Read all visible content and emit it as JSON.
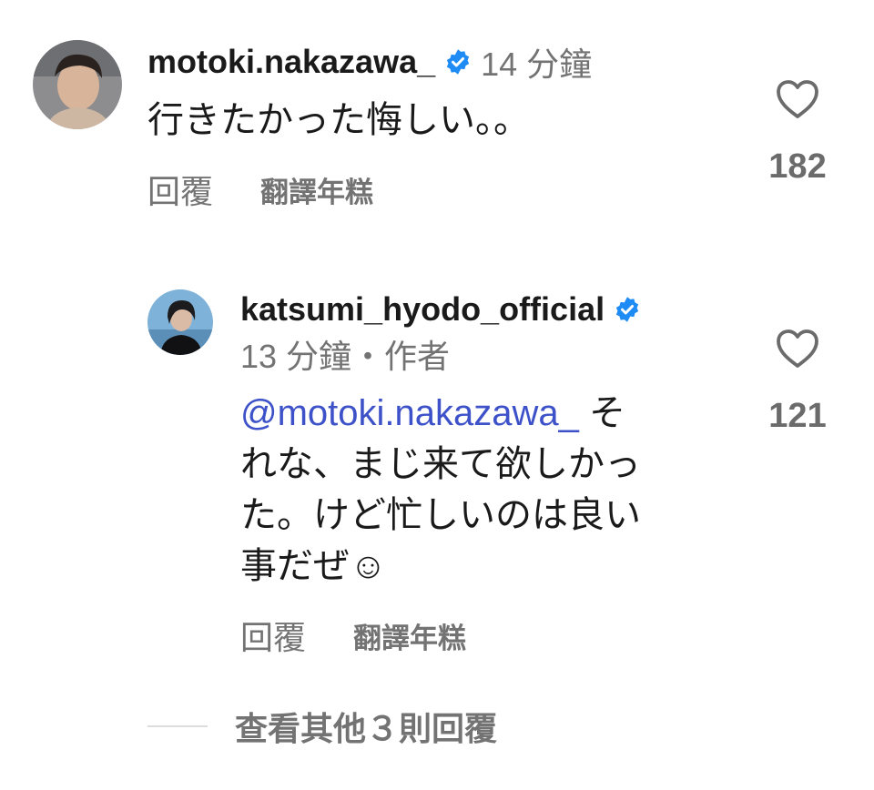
{
  "colors": {
    "text": "#1a1a1a",
    "secondary": "#737373",
    "mention": "#3d52c9",
    "verified": "#1f8cf5"
  },
  "comments": [
    {
      "username": "motoki.nakazawa_",
      "verified": true,
      "timestamp": "14 分鐘",
      "text": "行きたかった悔しい。。",
      "reply_label": "回覆",
      "translate_label": "翻譯年糕",
      "like_icon": "heart-outline-icon",
      "like_count": "182"
    }
  ],
  "reply": {
    "username": "katsumi_hyodo_official",
    "verified": true,
    "meta": "13 分鐘・作者",
    "mention": "@motoki.nakazawa_",
    "text_lines": [
      " そ",
      "れな、まじ来て欲しかっ",
      "た。けど忙しいのは良い",
      "事だぜ☺"
    ],
    "reply_label": "回覆",
    "translate_label": "翻譯年糕",
    "like_icon": "heart-outline-icon",
    "like_count": "121"
  },
  "view_more": {
    "label": "查看其他３則回覆"
  }
}
